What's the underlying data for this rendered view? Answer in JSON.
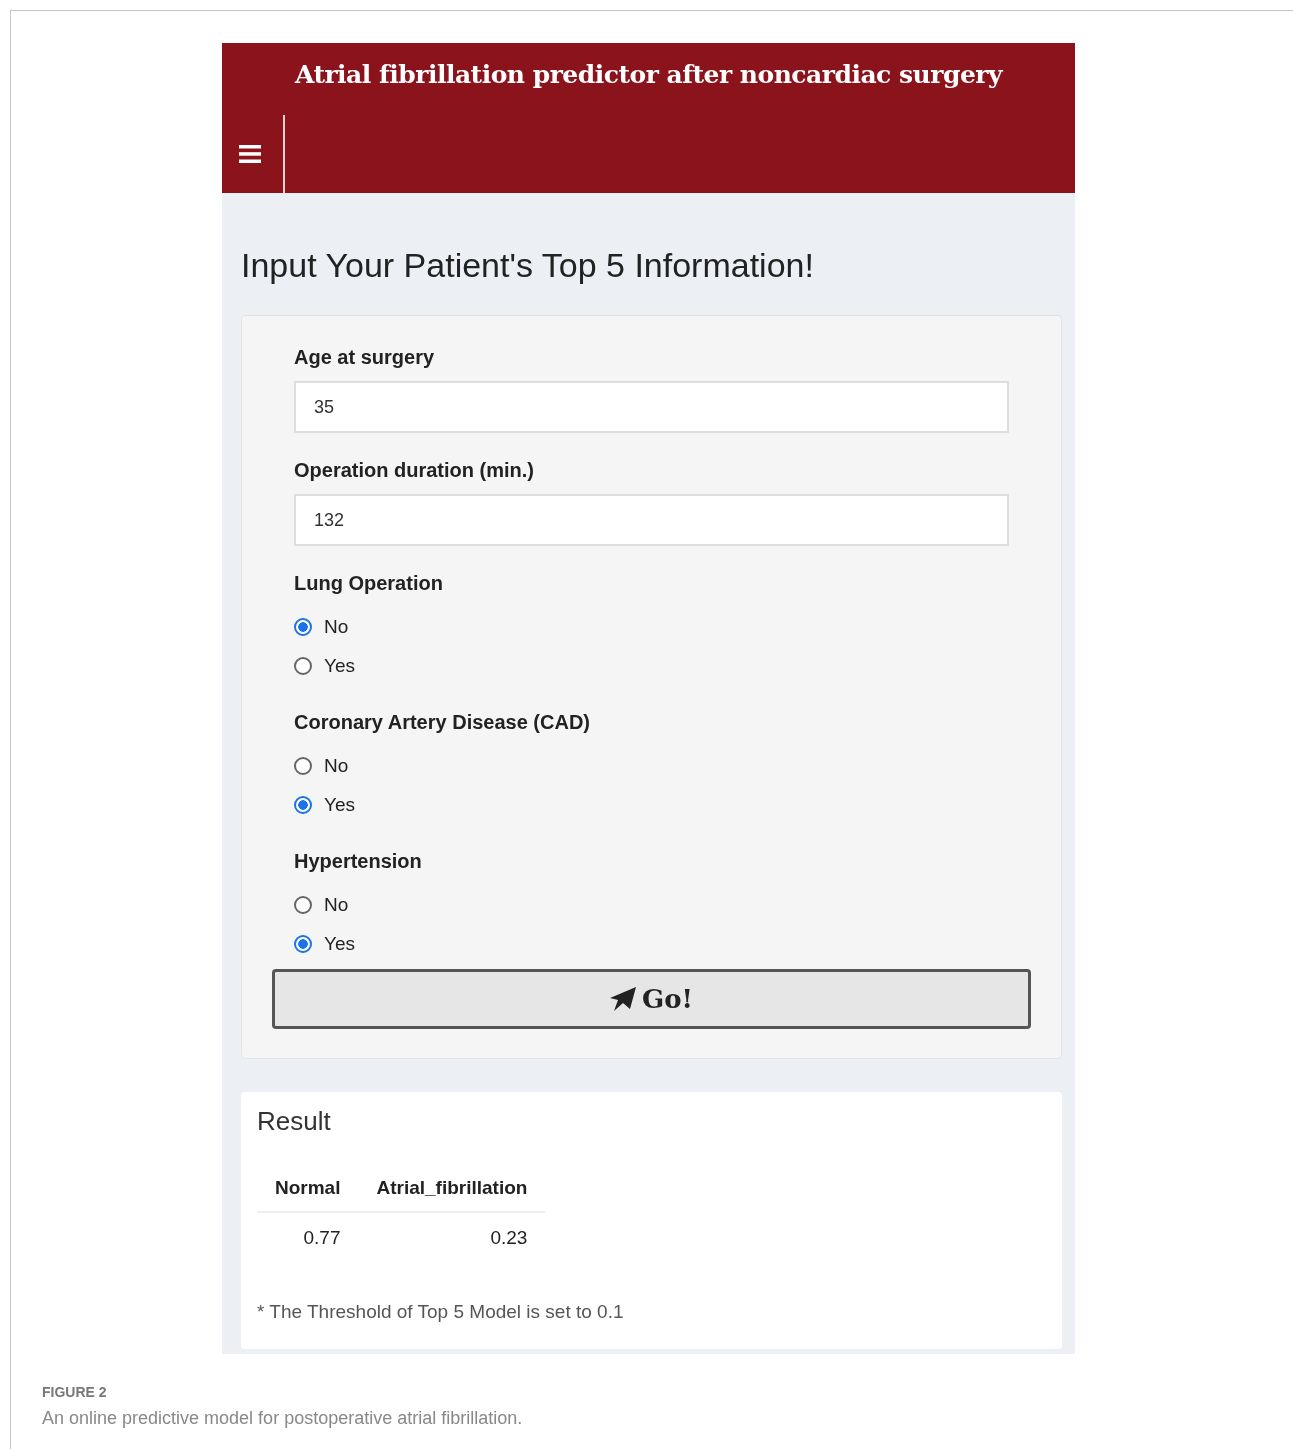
{
  "header": {
    "title": "Atrial fibrillation predictor after noncardiac surgery"
  },
  "heading": "Input Your Patient's Top 5 Information!",
  "inputs": [
    {
      "kind": "text",
      "label": "Age at surgery",
      "value": "35"
    },
    {
      "kind": "text",
      "label": "Operation duration (min.)",
      "value": "132"
    },
    {
      "kind": "radio",
      "label": "Lung Operation",
      "options": [
        {
          "label": "No",
          "selected": true
        },
        {
          "label": "Yes",
          "selected": false
        }
      ]
    },
    {
      "kind": "radio",
      "label": "Coronary Artery Disease (CAD)",
      "options": [
        {
          "label": "No",
          "selected": false
        },
        {
          "label": "Yes",
          "selected": true
        }
      ]
    },
    {
      "kind": "radio",
      "label": "Hypertension",
      "options": [
        {
          "label": "No",
          "selected": false
        },
        {
          "label": "Yes",
          "selected": true
        }
      ]
    }
  ],
  "go_button": {
    "label": "Go!"
  },
  "result": {
    "title": "Result",
    "table": {
      "columns": [
        "Normal",
        "Atrial_fibrillation"
      ],
      "rows": [
        [
          "0.77",
          "0.23"
        ]
      ]
    },
    "note": "* The Threshold of Top 5 Model is set to 0.1"
  },
  "figure": {
    "label": "FIGURE 2",
    "caption": "An online predictive model for postoperative atrial fibrillation."
  }
}
